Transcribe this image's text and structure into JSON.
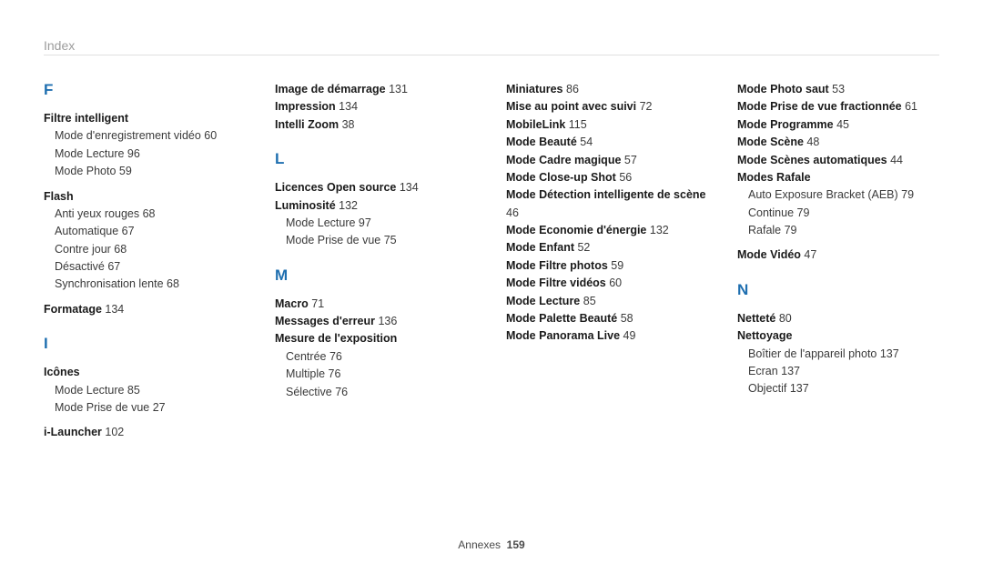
{
  "header": "Index",
  "footer_label": "Annexes",
  "footer_page": "159",
  "columns": [
    [
      {
        "type": "letter",
        "text": "F"
      },
      {
        "type": "entry",
        "text": "Filtre intelligent"
      },
      {
        "type": "sub",
        "text": "Mode d'enregistrement vidéo  60"
      },
      {
        "type": "sub",
        "text": "Mode Lecture  96"
      },
      {
        "type": "sub",
        "text": "Mode Photo  59",
        "end": true
      },
      {
        "type": "entry",
        "text": "Flash"
      },
      {
        "type": "sub",
        "text": "Anti yeux rouges  68"
      },
      {
        "type": "sub",
        "text": "Automatique  67"
      },
      {
        "type": "sub",
        "text": "Contre jour  68"
      },
      {
        "type": "sub",
        "text": "Désactivé  67"
      },
      {
        "type": "sub",
        "text": "Synchronisation lente  68",
        "end": true
      },
      {
        "type": "entry",
        "text": "Formatage",
        "page": "134",
        "end": true
      },
      {
        "type": "letter",
        "text": "I"
      },
      {
        "type": "entry",
        "text": "Icônes"
      },
      {
        "type": "sub",
        "text": "Mode Lecture  85"
      },
      {
        "type": "sub",
        "text": "Mode Prise de vue  27",
        "end": true
      },
      {
        "type": "entry",
        "text": "i-Launcher",
        "page": "102"
      }
    ],
    [
      {
        "type": "entry",
        "text": "Image de démarrage",
        "page": "131"
      },
      {
        "type": "entry",
        "text": "Impression",
        "page": "134"
      },
      {
        "type": "entry",
        "text": "Intelli Zoom",
        "page": "38",
        "end": true
      },
      {
        "type": "letter",
        "text": "L"
      },
      {
        "type": "entry",
        "text": "Licences Open source",
        "page": "134"
      },
      {
        "type": "entry",
        "text": "Luminosité",
        "page": "132"
      },
      {
        "type": "sub",
        "text": "Mode Lecture  97"
      },
      {
        "type": "sub",
        "text": "Mode Prise de vue  75",
        "end": true
      },
      {
        "type": "letter",
        "text": "M"
      },
      {
        "type": "entry",
        "text": "Macro",
        "page": "71"
      },
      {
        "type": "entry",
        "text": "Messages d'erreur",
        "page": "136"
      },
      {
        "type": "entry",
        "text": "Mesure de l'exposition"
      },
      {
        "type": "sub",
        "text": "Centrée  76"
      },
      {
        "type": "sub",
        "text": "Multiple  76"
      },
      {
        "type": "sub",
        "text": "Sélective  76"
      }
    ],
    [
      {
        "type": "entry",
        "text": "Miniatures",
        "page": "86"
      },
      {
        "type": "entry",
        "text": "Mise au point avec suivi",
        "page": "72"
      },
      {
        "type": "entry",
        "text": "MobileLink",
        "page": "115"
      },
      {
        "type": "entry",
        "text": "Mode Beauté",
        "page": "54"
      },
      {
        "type": "entry",
        "text": "Mode Cadre magique",
        "page": "57"
      },
      {
        "type": "entry",
        "text": "Mode Close-up Shot",
        "page": "56"
      },
      {
        "type": "entry",
        "text": "Mode Détection intelligente de scène",
        "page": "46"
      },
      {
        "type": "entry",
        "text": "Mode Economie d'énergie",
        "page": "132"
      },
      {
        "type": "entry",
        "text": "Mode Enfant",
        "page": "52"
      },
      {
        "type": "entry",
        "text": "Mode Filtre photos",
        "page": "59"
      },
      {
        "type": "entry",
        "text": "Mode Filtre vidéos",
        "page": "60"
      },
      {
        "type": "entry",
        "text": "Mode Lecture",
        "page": "85"
      },
      {
        "type": "entry",
        "text": "Mode Palette Beauté",
        "page": "58"
      },
      {
        "type": "entry",
        "text": "Mode Panorama Live",
        "page": "49"
      }
    ],
    [
      {
        "type": "entry",
        "text": "Mode Photo saut",
        "page": "53"
      },
      {
        "type": "entry",
        "text": "Mode Prise de vue fractionnée",
        "page": "61"
      },
      {
        "type": "entry",
        "text": "Mode Programme",
        "page": "45"
      },
      {
        "type": "entry",
        "text": "Mode Scène",
        "page": "48"
      },
      {
        "type": "entry",
        "text": "Mode Scènes automatiques",
        "page": "44"
      },
      {
        "type": "entry",
        "text": "Modes Rafale"
      },
      {
        "type": "sub",
        "text": "Auto Exposure Bracket (AEB)  79"
      },
      {
        "type": "sub",
        "text": "Continue  79"
      },
      {
        "type": "sub",
        "text": "Rafale  79",
        "end": true
      },
      {
        "type": "entry",
        "text": "Mode Vidéo",
        "page": "47",
        "end": true
      },
      {
        "type": "letter",
        "text": "N"
      },
      {
        "type": "entry",
        "text": "Netteté",
        "page": "80"
      },
      {
        "type": "entry",
        "text": "Nettoyage"
      },
      {
        "type": "sub",
        "text": "Boîtier de l'appareil photo  137"
      },
      {
        "type": "sub",
        "text": "Ecran  137"
      },
      {
        "type": "sub",
        "text": "Objectif  137"
      }
    ]
  ]
}
